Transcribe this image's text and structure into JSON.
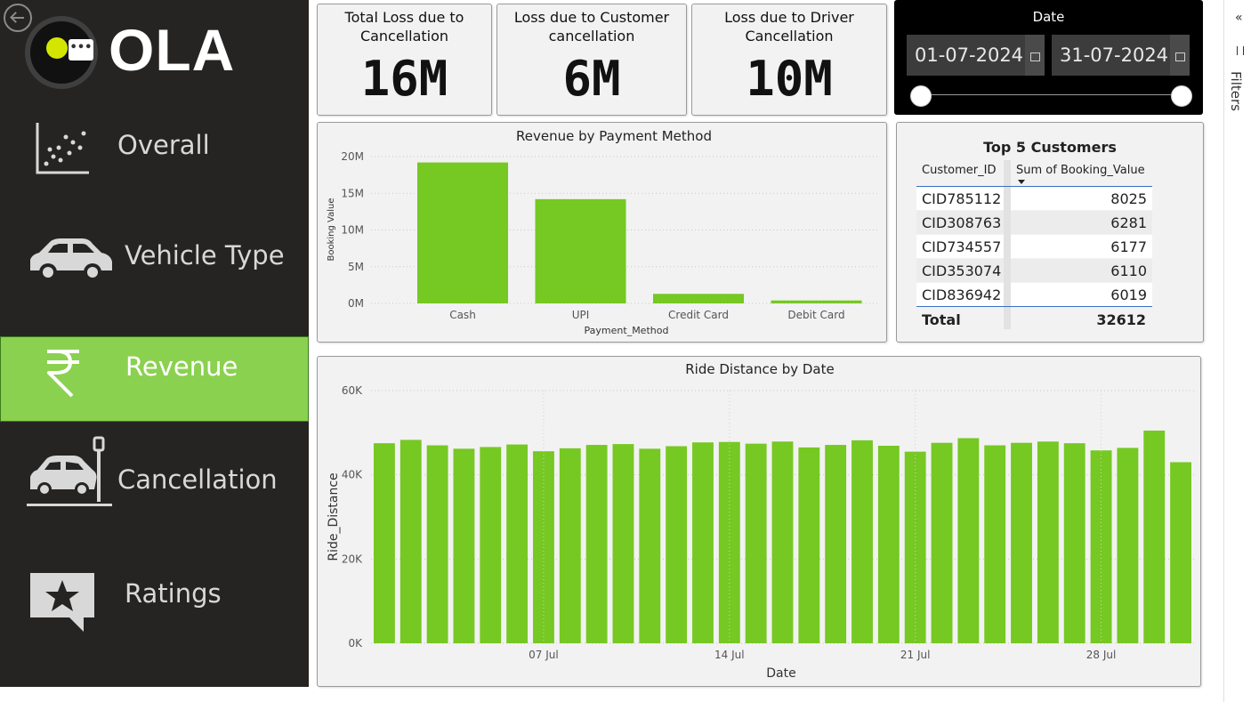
{
  "sidebar": {
    "logo_text": "OLA",
    "more_label": "•••",
    "items": [
      {
        "label": "Overall",
        "icon": "scatter-chart-icon"
      },
      {
        "label": "Vehicle Type",
        "icon": "car-icon"
      },
      {
        "label": "Revenue",
        "icon": "rupee-icon",
        "active": true
      },
      {
        "label": "Cancellation",
        "icon": "car-crash-icon"
      },
      {
        "label": "Ratings",
        "icon": "star-speech-bubble-icon"
      }
    ],
    "active_color": "#8bd150",
    "background": "#252423"
  },
  "kpis": [
    {
      "title": "Total Loss due to Cancellation",
      "value": "16M"
    },
    {
      "title": "Loss due to Customer cancellation",
      "value": "6M"
    },
    {
      "title": "Loss due to Driver Cancellation",
      "value": "10M"
    }
  ],
  "date_slicer": {
    "title": "Date",
    "start": "01-07-2024",
    "end": "31-07-2024"
  },
  "top_customers": {
    "title": "Top 5 Customers",
    "columns": [
      "Customer_ID",
      "Sum of Booking_Value"
    ],
    "rows": [
      [
        "CID785112",
        "8025"
      ],
      [
        "CID308763",
        "6281"
      ],
      [
        "CID734557",
        "6177"
      ],
      [
        "CID353074",
        "6110"
      ],
      [
        "CID836942",
        "6019"
      ]
    ],
    "total_label": "Total",
    "total_value": "32612"
  },
  "filters_label": "Filters",
  "chart_data": [
    {
      "type": "bar",
      "title": "Revenue by Payment Method",
      "xlabel": "Payment_Method",
      "ylabel": "Booking Value",
      "categories": [
        "Cash",
        "UPI",
        "Credit Card",
        "Debit Card"
      ],
      "values": [
        19200000,
        14200000,
        1300000,
        400000
      ],
      "ylim": [
        0,
        20000000
      ],
      "yticks": [
        "0M",
        "5M",
        "10M",
        "15M",
        "20M"
      ],
      "grid": true,
      "color": "#76c823"
    },
    {
      "type": "bar",
      "title": "Ride Distance by Date",
      "xlabel": "Date",
      "ylabel": "Ride_Distance",
      "x": [
        "2024-07-01",
        "2024-07-02",
        "2024-07-03",
        "2024-07-04",
        "2024-07-05",
        "2024-07-06",
        "2024-07-07",
        "2024-07-08",
        "2024-07-09",
        "2024-07-10",
        "2024-07-11",
        "2024-07-12",
        "2024-07-13",
        "2024-07-14",
        "2024-07-15",
        "2024-07-16",
        "2024-07-17",
        "2024-07-18",
        "2024-07-19",
        "2024-07-20",
        "2024-07-21",
        "2024-07-22",
        "2024-07-23",
        "2024-07-24",
        "2024-07-25",
        "2024-07-26",
        "2024-07-27",
        "2024-07-28",
        "2024-07-29",
        "2024-07-30",
        "2024-07-31"
      ],
      "values": [
        47500,
        48300,
        47000,
        46200,
        46600,
        47200,
        45600,
        46300,
        47100,
        47300,
        46200,
        46800,
        47700,
        47800,
        47400,
        47900,
        46500,
        47100,
        48200,
        46900,
        45500,
        47600,
        48700,
        47000,
        47600,
        47900,
        47500,
        45800,
        46400,
        50500,
        43000
      ],
      "ylim": [
        0,
        60000
      ],
      "yticks": [
        "0K",
        "20K",
        "40K",
        "60K"
      ],
      "xticks": [
        "07 Jul",
        "14 Jul",
        "21 Jul",
        "28 Jul"
      ],
      "grid": true,
      "color": "#76c823"
    }
  ]
}
